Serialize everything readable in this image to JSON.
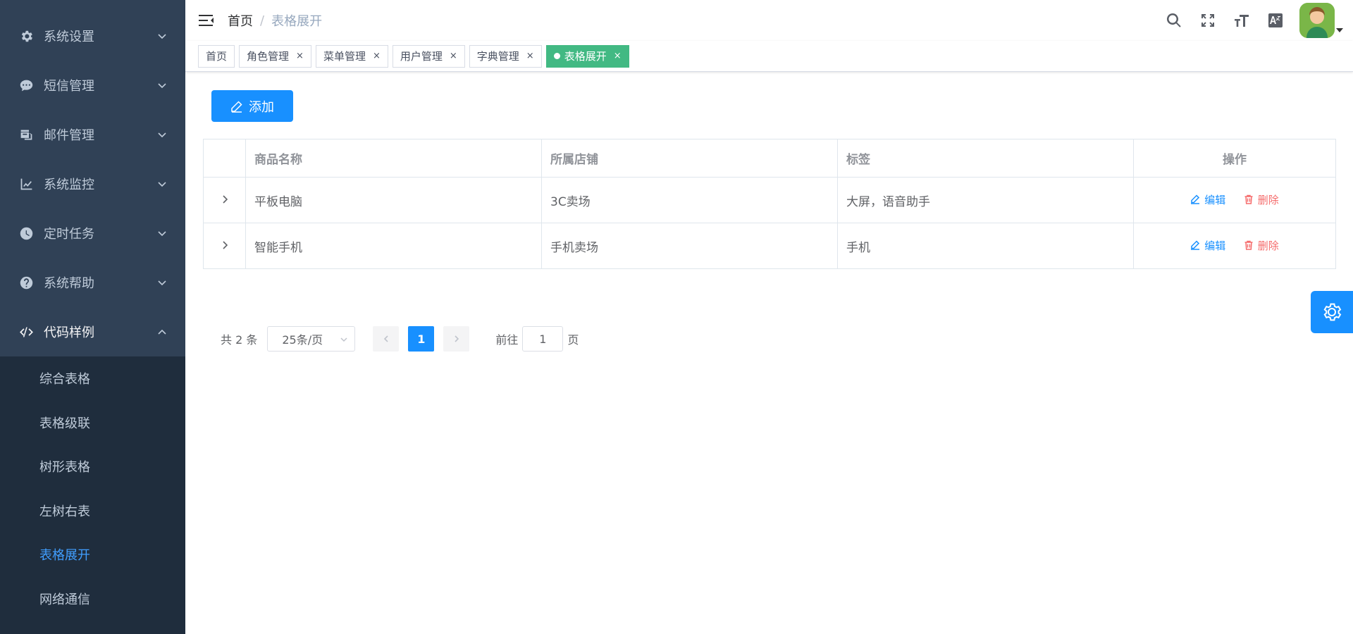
{
  "sidebar": {
    "items": [
      {
        "label": "系统设置",
        "icon": "gear-icon"
      },
      {
        "label": "短信管理",
        "icon": "sms-icon"
      },
      {
        "label": "邮件管理",
        "icon": "mail-icon"
      },
      {
        "label": "系统监控",
        "icon": "chart-icon"
      },
      {
        "label": "定时任务",
        "icon": "clock-icon"
      },
      {
        "label": "系统帮助",
        "icon": "help-icon"
      },
      {
        "label": "代码样例",
        "icon": "code-icon"
      }
    ],
    "sub_items": [
      {
        "label": "综合表格"
      },
      {
        "label": "表格级联"
      },
      {
        "label": "树形表格"
      },
      {
        "label": "左树右表"
      },
      {
        "label": "表格展开"
      },
      {
        "label": "网络通信"
      }
    ],
    "active_sub": "表格展开"
  },
  "navbar": {
    "breadcrumb_home": "首页",
    "breadcrumb_sep": "/",
    "breadcrumb_current": "表格展开"
  },
  "tags": [
    {
      "label": "首页"
    },
    {
      "label": "角色管理"
    },
    {
      "label": "菜单管理"
    },
    {
      "label": "用户管理"
    },
    {
      "label": "字典管理"
    },
    {
      "label": "表格展开"
    }
  ],
  "toolbar": {
    "add_label": "添加"
  },
  "table": {
    "headers": {
      "name": "商品名称",
      "shop": "所属店铺",
      "tags": "标签",
      "ops": "操作"
    },
    "rows": [
      {
        "name": "平板电脑",
        "shop": "3C卖场",
        "tags": "大屏，语音助手"
      },
      {
        "name": "智能手机",
        "shop": "手机卖场",
        "tags": "手机"
      }
    ],
    "edit_label": "编辑",
    "delete_label": "删除"
  },
  "pagination": {
    "total": "共 2 条",
    "page_size": "25条/页",
    "current_page": "1",
    "goto_label": "前往",
    "goto_value": "1",
    "page_unit": "页"
  },
  "colors": {
    "sidebar_bg": "#304156",
    "submenu_bg": "#1f2d3d",
    "primary": "#1890ff",
    "active_tag": "#42b983",
    "danger": "#f56c6c"
  }
}
